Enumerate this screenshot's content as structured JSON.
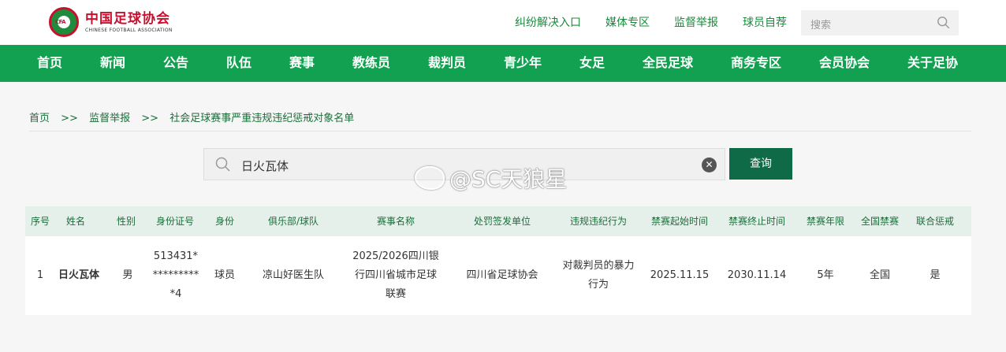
{
  "header": {
    "logo_cn": "中国足球协会",
    "logo_en": "CHINESE FOOTBALL ASSOCIATION",
    "logo_badge": "CFA",
    "top_links": [
      "纠纷解决入口",
      "媒体专区",
      "监督举报",
      "球员自荐"
    ],
    "search_placeholder": "搜索"
  },
  "nav": [
    "首页",
    "新闻",
    "公告",
    "队伍",
    "赛事",
    "教练员",
    "裁判员",
    "青少年",
    "女足",
    "全民足球",
    "商务专区",
    "会员协会",
    "关于足协"
  ],
  "breadcrumb": [
    "首页",
    ">>",
    "监督举报",
    ">>",
    "社会足球赛事严重违规违纪惩戒对象名单"
  ],
  "query": {
    "value": "日火瓦体",
    "clear_glyph": "✕",
    "button": "查询"
  },
  "watermark": "@SC天狼星",
  "table": {
    "headers": [
      "序号",
      "姓名",
      "性别",
      "身份证号",
      "身份",
      "俱乐部/球队",
      "赛事名称",
      "处罚签发单位",
      "违规违纪行为",
      "禁赛起始时间",
      "禁赛终止时间",
      "禁赛年限",
      "全国禁赛",
      "联合惩戒"
    ],
    "rows": [
      [
        "1",
        "日火瓦体",
        "男",
        "513431*\n*********\n*4",
        "球员",
        "凉山好医生队",
        "2025/2026四川银\n行四川省城市足球\n联赛",
        "四川省足球协会",
        "对裁判员的暴力\n行为",
        "2025.11.15",
        "2030.11.14",
        "5年",
        "全国",
        "是"
      ]
    ]
  },
  "colors": {
    "nav_green": "#12a150",
    "button_green": "#0f6b47",
    "link_green": "#1a8a3c",
    "logo_red": "#c8102e"
  }
}
